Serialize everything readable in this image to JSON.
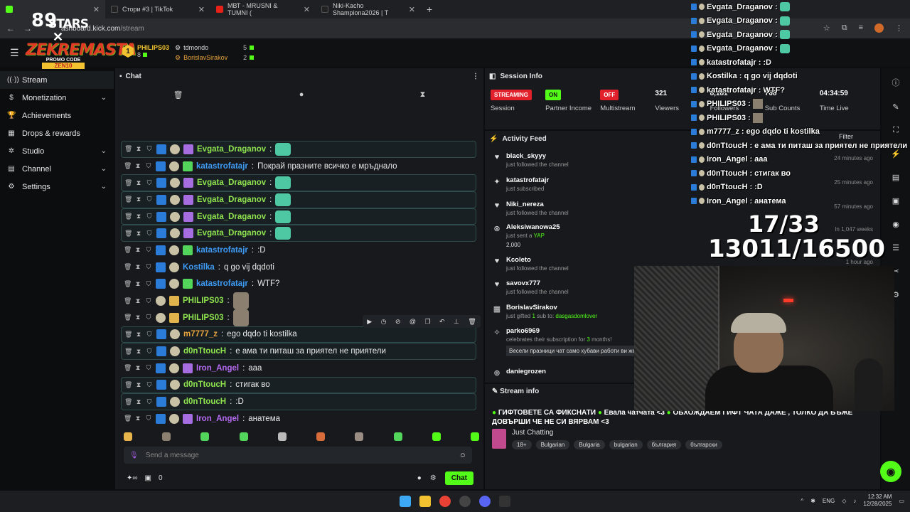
{
  "browser": {
    "tabs": [
      {
        "label": "",
        "color": "#53fc18"
      },
      {
        "label": "Стори #3 | TikTok",
        "color": "#222"
      },
      {
        "label": "МВТ - MRUSNI & TUMNI (",
        "color": "#e62117"
      },
      {
        "label": "Niki-Kacho Shampiona2026 | T",
        "color": "#222"
      }
    ],
    "url_prefix": "ashboard.kick.com",
    "url_path": "/stream"
  },
  "overlay": {
    "stars_number": "89",
    "stars_label": "STARS",
    "logo_text": "ZEKREMASTA",
    "promo_label": "PROMO CODE",
    "promo_code": "ZEN10",
    "goal_count": "17/33",
    "goal_money": "13011/16500"
  },
  "sidebar": {
    "items": [
      {
        "label": "Stream",
        "icon": "broadcast-icon",
        "chevron": false
      },
      {
        "label": "Monetization",
        "icon": "dollar-icon",
        "chevron": true
      },
      {
        "label": "Achievements",
        "icon": "trophy-icon",
        "chevron": false
      },
      {
        "label": "Drops & rewards",
        "icon": "gift-icon",
        "chevron": false
      },
      {
        "label": "Studio",
        "icon": "settings-icon",
        "chevron": true
      },
      {
        "label": "Channel",
        "icon": "channel-icon",
        "chevron": true
      },
      {
        "label": "Settings",
        "icon": "gear-icon",
        "chevron": true
      }
    ]
  },
  "chat": {
    "title": "Chat",
    "leaderboard": [
      {
        "rank": "1",
        "name": "PHILIPS03",
        "count": "8"
      },
      {
        "name": "tdmondo",
        "count": "5"
      },
      {
        "name": "BorislavSirakov",
        "count": "2"
      }
    ],
    "messages": [
      {
        "user": "Evgata_Draganov",
        "color": "#8fe34f",
        "text": "",
        "emote": "green",
        "hl": true,
        "badges": [
          "blue",
          "av",
          "gift"
        ]
      },
      {
        "user": "katastrofatajr",
        "color": "#3e9bf5",
        "text": "Покрай празните всичко е мръднало",
        "emote": "",
        "hl": false,
        "badges": [
          "blue",
          "av",
          "giftg"
        ]
      },
      {
        "user": "Evgata_Draganov",
        "color": "#8fe34f",
        "text": "",
        "emote": "green",
        "hl": true,
        "badges": [
          "blue",
          "av",
          "gift"
        ]
      },
      {
        "user": "Evgata_Draganov",
        "color": "#8fe34f",
        "text": "",
        "emote": "green",
        "hl": true,
        "badges": [
          "blue",
          "av",
          "gift"
        ]
      },
      {
        "user": "Evgata_Draganov",
        "color": "#8fe34f",
        "text": "",
        "emote": "green",
        "hl": true,
        "badges": [
          "blue",
          "av",
          "gift"
        ]
      },
      {
        "user": "Evgata_Draganov",
        "color": "#8fe34f",
        "text": "",
        "emote": "green",
        "hl": true,
        "badges": [
          "blue",
          "av",
          "gift"
        ]
      },
      {
        "user": "katastrofatajr",
        "color": "#3e9bf5",
        "text": ":D",
        "emote": "",
        "hl": false,
        "badges": [
          "blue",
          "av",
          "giftg"
        ]
      },
      {
        "user": "Kostilka",
        "color": "#3e9bf5",
        "text": "q go vij dqdoti",
        "emote": "",
        "hl": false,
        "badges": [
          "blue",
          "av"
        ]
      },
      {
        "user": "katastrofatajr",
        "color": "#3e9bf5",
        "text": "WTF?",
        "emote": "",
        "hl": false,
        "badges": [
          "blue",
          "av",
          "giftg"
        ]
      },
      {
        "user": "PHILIPS03",
        "color": "#8fe34f",
        "text": "",
        "emote": "pic",
        "hl": false,
        "badges": [
          "av",
          "giftw"
        ]
      },
      {
        "user": "PHILIPS03",
        "color": "#8fe34f",
        "text": "",
        "emote": "pic",
        "hl": false,
        "badges": [
          "av",
          "giftw"
        ]
      },
      {
        "user": "m7777_z",
        "color": "#e8a23b",
        "text": "ego dqdo ti kostilka",
        "emote": "",
        "hl": true,
        "badges": [
          "blue",
          "av"
        ]
      },
      {
        "user": "d0nTtoucH",
        "color": "#8fe34f",
        "text": "е ама ти питаш за приятел не приятели",
        "emote": "",
        "hl": true,
        "badges": [
          "blue",
          "av"
        ]
      },
      {
        "user": "Iron_Angel",
        "color": "#b56bf2",
        "text": "aaa",
        "emote": "",
        "hl": false,
        "badges": [
          "blue",
          "av",
          "gift"
        ]
      },
      {
        "user": "d0nTtoucH",
        "color": "#8fe34f",
        "text": "стигак во",
        "emote": "",
        "hl": true,
        "badges": [
          "blue",
          "av"
        ]
      },
      {
        "user": "d0nTtoucH",
        "color": "#8fe34f",
        "text": ":D",
        "emote": "",
        "hl": true,
        "badges": [
          "blue",
          "av"
        ]
      },
      {
        "user": "Iron_Angel",
        "color": "#b56bf2",
        "text": "анатема",
        "emote": "",
        "hl": false,
        "badges": [
          "blue",
          "av",
          "gift"
        ]
      }
    ],
    "input_placeholder": "Send a message",
    "footer_count": "0",
    "send_label": "Chat"
  },
  "session": {
    "title": "Session Info",
    "stats": [
      {
        "pill": "STREAMING",
        "pill_type": "red",
        "label": "Session",
        "value": ""
      },
      {
        "pill": "ON",
        "pill_type": "green",
        "label": "Partner Income",
        "value": ""
      },
      {
        "pill": "OFF",
        "pill_type": "red",
        "label": "Multistream",
        "value": ""
      },
      {
        "pill": "",
        "pill_type": "",
        "label": "Viewers",
        "value": "321"
      },
      {
        "pill": "",
        "pill_type": "",
        "label": "Followers",
        "value": "8,181"
      },
      {
        "pill": "",
        "pill_type": "",
        "label": "Sub Counts",
        "value": "768"
      },
      {
        "pill": "",
        "pill_type": "",
        "label": "Time Live",
        "value": "04:34:59"
      }
    ]
  },
  "activity": {
    "title": "Activity Feed",
    "filter_label": "Filter",
    "items": [
      {
        "icon": "heart-icon",
        "user": "black_skyyy",
        "sub": "just followed the channel",
        "time": "24 minutes ago"
      },
      {
        "icon": "star-icon",
        "user": "katastrofatajr",
        "sub": "just subscribed",
        "time": "25 minutes ago"
      },
      {
        "icon": "heart-icon",
        "user": "Niki_nereza",
        "sub": "just followed the channel",
        "time": "57 minutes ago"
      },
      {
        "icon": "kick-icon",
        "user": "Aleksiwanowa25",
        "sub_pre": "just sent a ",
        "sub_hl": "YAP",
        "amount": "2,000",
        "time": "In 1,047 weeks"
      },
      {
        "icon": "heart-icon",
        "user": "Kcoleto",
        "sub": "just followed the channel",
        "time": "1 hour ago"
      },
      {
        "icon": "heart-icon",
        "user": "savovx777",
        "sub": "just followed the channel",
        "time": ""
      },
      {
        "icon": "gift-icon",
        "user": "BorislavSirakov",
        "sub_pre": "just gifted ",
        "sub_num": "1",
        "sub_mid": " sub to: ",
        "sub_link": "dasgasdomlover",
        "time": ""
      },
      {
        "icon": "resub-icon",
        "user": "parko6969",
        "sub_pre": "celebrates their subscription for ",
        "sub_num": "3",
        "sub_mid": " months!",
        "quote": "Весели празници чат само хубави работи ви жел",
        "time": ""
      },
      {
        "icon": "follow-icon",
        "user": "daniegrozen",
        "sub": "",
        "time": ""
      }
    ]
  },
  "stream_info": {
    "title": "Stream info",
    "text_a": "ГИФТОВЕТЕ СА ФИКСНАТИ",
    "text_b": "Евала чатчата <3",
    "text_c": "ОБХОЖДАЕМ ГИФТ ЧАТА ДАЖЕ , ТОЛКО ДА БЪЖЕ ДОВЪРШИ ЧЕ НЕ СИ ВЯРВАМ <3",
    "category": "Just Chatting",
    "tags": [
      "18+",
      "Bulgarian",
      "Bulgaria",
      "bulgarian",
      "българия",
      "български"
    ]
  },
  "overlay_chat": [
    {
      "user": "Evgata_Draganov",
      "text": "",
      "emote": "em"
    },
    {
      "user": "Evgata_Draganov",
      "text": "",
      "emote": "em"
    },
    {
      "user": "Evgata_Draganov",
      "text": "",
      "emote": "em"
    },
    {
      "user": "Evgata_Draganov",
      "text": "",
      "emote": "em"
    },
    {
      "user": "katastrofatajr",
      "text": ":D",
      "emote": ""
    },
    {
      "user": "Kostilka",
      "text": "q go vij dqdoti",
      "emote": ""
    },
    {
      "user": "katastrofatajr",
      "text": "WTF?",
      "emote": ""
    },
    {
      "user": "PHILIPS03",
      "text": "",
      "emote": "emp"
    },
    {
      "user": "PHILIPS03",
      "text": "",
      "emote": "emp"
    },
    {
      "user": "m7777_z",
      "text": "ego dqdo ti kostilka",
      "emote": ""
    },
    {
      "user": "d0nTtoucH",
      "text": "е ама ти питаш за приятел не приятели",
      "emote": ""
    },
    {
      "user": "Iron_Angel",
      "text": "aaa",
      "emote": ""
    },
    {
      "user": "d0nTtoucH",
      "text": "стигак во",
      "emote": ""
    },
    {
      "user": "d0nTtoucH",
      "text": ":D",
      "emote": ""
    },
    {
      "user": "Iron_Angel",
      "text": "анатема",
      "emote": ""
    }
  ],
  "taskbar": {
    "lang": "ENG",
    "time": "12:32 AM",
    "date": "12/28/2025"
  }
}
